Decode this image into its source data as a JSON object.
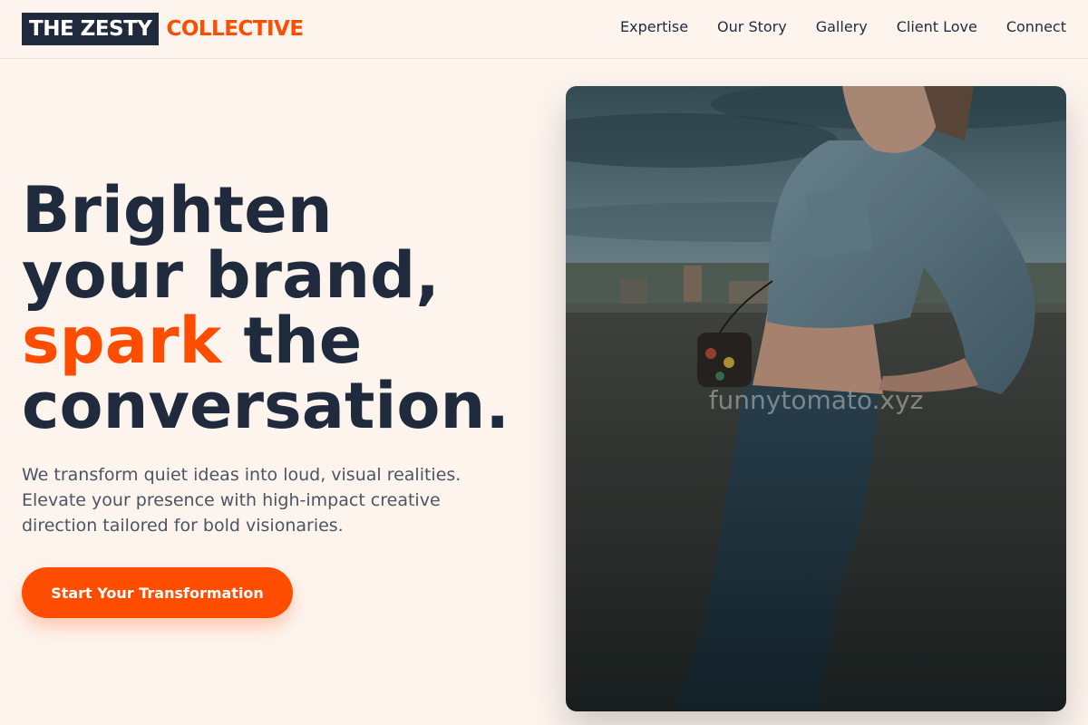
{
  "brand": {
    "name_box": "THE ZESTY",
    "name_accent": "COLLECTIVE"
  },
  "nav": {
    "items": [
      "Expertise",
      "Our Story",
      "Gallery",
      "Client Love",
      "Connect"
    ]
  },
  "hero": {
    "headline": {
      "line1": "Brighten",
      "line2": "your brand,",
      "line3_accent": "spark",
      "line3_rest": " the",
      "line4": "conversation."
    },
    "lead": "We transform quiet ideas into loud, visual realities. Elevate your presence with high-impact creative direction tailored for bold visionaries.",
    "cta_label": "Start Your Transformation",
    "photo": {
      "watermark": "funnytomato.xyz",
      "icon": "photo-of-woman-in-denim-jacket"
    }
  },
  "colors": {
    "background": "#fdf4ee",
    "navy": "#1f2a3d",
    "accent": "#ff4d00",
    "body_text": "#4b5563"
  }
}
